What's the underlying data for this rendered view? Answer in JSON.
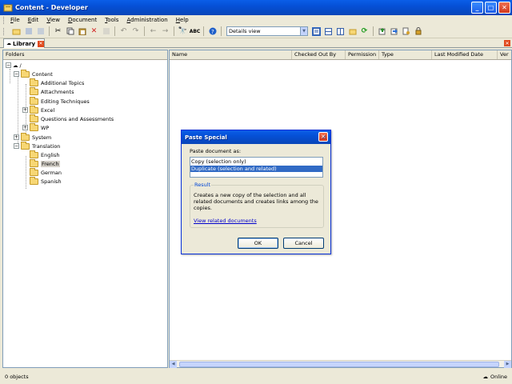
{
  "window": {
    "title": "Content - Developer"
  },
  "menu": [
    {
      "pre": "",
      "u": "F",
      "post": "ile"
    },
    {
      "pre": "",
      "u": "E",
      "post": "dit"
    },
    {
      "pre": "",
      "u": "V",
      "post": "iew"
    },
    {
      "pre": "",
      "u": "D",
      "post": "ocument"
    },
    {
      "pre": "",
      "u": "T",
      "post": "ools"
    },
    {
      "pre": "",
      "u": "A",
      "post": "dministration"
    },
    {
      "pre": "",
      "u": "H",
      "post": "elp"
    }
  ],
  "toolbar": {
    "view_select_value": "Details view"
  },
  "tabs": {
    "library_label": "Library"
  },
  "folder_pane": {
    "header": "Folders",
    "tree": [
      {
        "label": "/",
        "level": 0
      },
      {
        "label": "Content",
        "level": 1
      },
      {
        "label": "Additional Topics",
        "level": 2
      },
      {
        "label": "Attachments",
        "level": 2
      },
      {
        "label": "Editing Techniques",
        "level": 2
      },
      {
        "label": "Excel",
        "level": 2
      },
      {
        "label": "Questions and Assessments",
        "level": 2
      },
      {
        "label": "WP",
        "level": 2
      },
      {
        "label": "System",
        "level": 1
      },
      {
        "label": "Translation",
        "level": 1
      },
      {
        "label": "English",
        "level": 2
      },
      {
        "label": "French",
        "level": 2,
        "selected": true
      },
      {
        "label": "German",
        "level": 2
      },
      {
        "label": "Spanish",
        "level": 2
      }
    ]
  },
  "document_pane": {
    "columns": [
      "Name",
      "Checked Out By",
      "Permission",
      "Type",
      "Last Modified Date",
      "Ver"
    ]
  },
  "statusbar": {
    "objects": "0 objects",
    "connection": "Online"
  },
  "dialog": {
    "title": "Paste Special",
    "paste_label": "Paste document as:",
    "options": [
      "Copy (selection only)",
      "Duplicate (selection and related)"
    ],
    "selected_option": 1,
    "result_legend": "Result",
    "result_text": "Creates a new copy of the selection and all related documents and creates links among the copies.",
    "link_text": "View related documents",
    "ok_label": "OK",
    "cancel_label": "Cancel"
  }
}
